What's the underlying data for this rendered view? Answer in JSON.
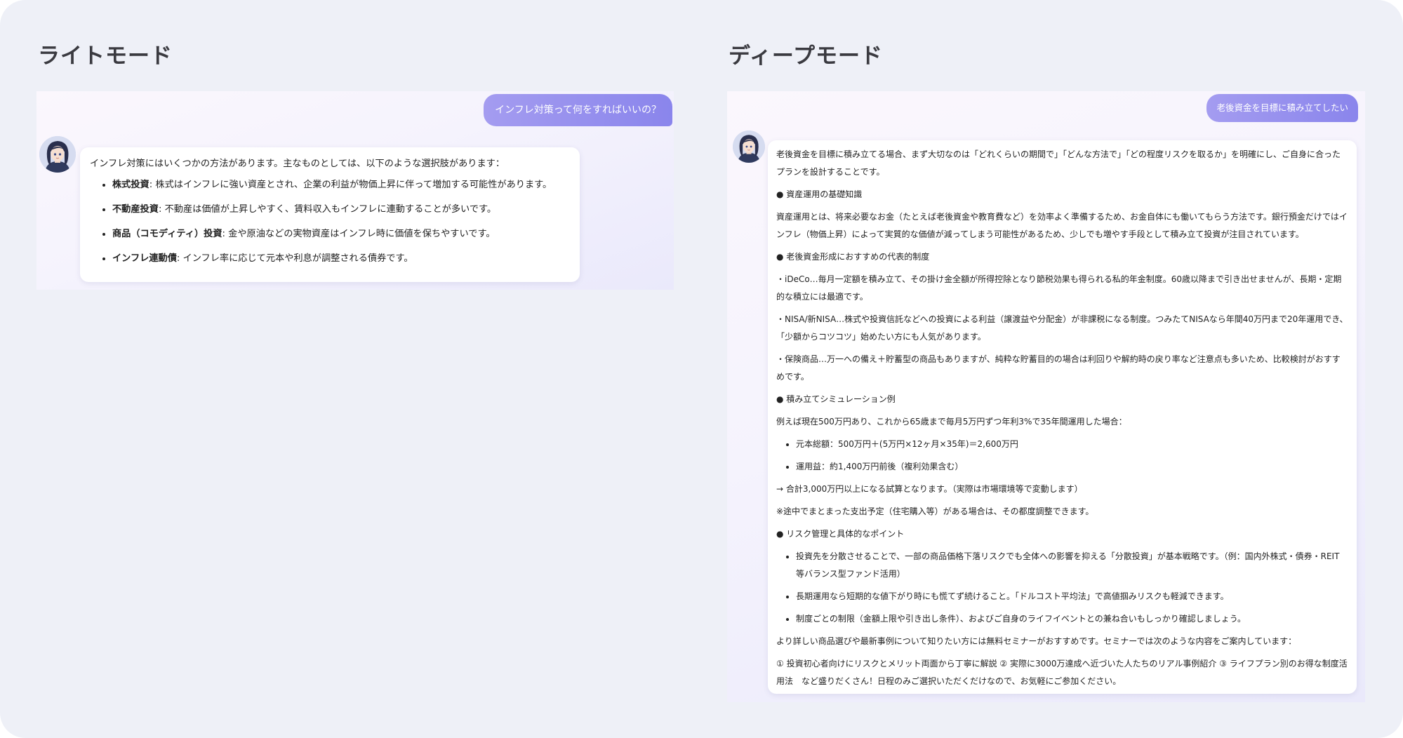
{
  "light": {
    "title": "ライトモード",
    "question": "インフレ対策って何をすればいいの？",
    "intro": "インフレ対策にはいくつかの方法があります。主なものとしては、以下のような選択肢があります：",
    "items": [
      {
        "term": "株式投資",
        "desc": ": 株式はインフレに強い資産とされ、企業の利益が物価上昇に伴って増加する可能性があります。"
      },
      {
        "term": "不動産投資",
        "desc": ": 不動産は価値が上昇しやすく、賃料収入もインフレに連動することが多いです。"
      },
      {
        "term": "商品（コモディティ）投資",
        "desc": ": 金や原油などの実物資産はインフレ時に価値を保ちやすいです。"
      },
      {
        "term": "インフレ連動債",
        "desc": ": インフレ率に応じて元本や利息が調整される債券です。"
      }
    ]
  },
  "deep": {
    "title": "ディープモード",
    "question": "老後資金を目標に積み立てしたい",
    "intro": "老後資金を目標に積み立てる場合、まず大切なのは「どれくらいの期間で」「どんな方法で」「どの程度リスクを取るか」を明確にし、ご自身に合ったプランを設計することです。",
    "h1": "● 資産運用の基礎知識",
    "p1": "資産運用とは、将来必要なお金（たとえば老後資金や教育費など）を効率よく準備するため、お金自体にも働いてもらう方法です。銀行預金だけではインフレ（物価上昇）によって実質的な価値が減ってしまう可能性があるため、少しでも増やす手段として積み立て投資が注目されています。",
    "h2": "● 老後資金形成におすすめの代表的制度",
    "p2": "・iDeCo…毎月一定額を積み立て、その掛け金全額が所得控除となり節税効果も得られる私的年金制度。60歳以降まで引き出せませんが、長期・定期的な積立には最適です。",
    "p3": "・NISA/新NISA…株式や投資信託などへの投資による利益（譲渡益や分配金）が非課税になる制度。つみたてNISAなら年間40万円まで20年運用でき、「少額からコツコツ」始めたい方にも人気があります。",
    "p4": "・保険商品…万一への備え＋貯蓄型の商品もありますが、純粋な貯蓄目的の場合は利回りや解約時の戻り率など注意点も多いため、比較検討がおすすめです。",
    "h3": "● 積み立てシミュレーション例",
    "p5": "例えば現在500万円あり、これから65歳まで毎月5万円ずつ年利3%で35年間運用した場合：",
    "sim": [
      "元本総額：500万円＋(5万円×12ヶ月×35年)＝2,600万円",
      "運用益：約1,400万円前後（複利効果含む）"
    ],
    "p6": "→ 合計3,000万円以上になる試算となります。（実際は市場環境等で変動します）",
    "p7": "※途中でまとまった支出予定（住宅購入等）がある場合は、その都度調整できます。",
    "h4": "● リスク管理と具体的なポイント",
    "risk": [
      "投資先を分散させることで、一部の商品価格下落リスクでも全体への影響を抑える「分散投資」が基本戦略です。（例：国内外株式・債券・REIT 等バランス型ファンド活用）",
      "長期運用なら短期的な値下がり時にも慌てず続けること。「ドルコスト平均法」で高値掴みリスクも軽減できます。",
      "制度ごとの制限（金額上限や引き出し条件）、およびご自身のライフイベントとの兼ね合いもしっかり確認しましょう。"
    ],
    "p8": "より詳しい商品選びや最新事例について知りたい方には無料セミナーがおすすめです。セミナーでは次のような内容をご案内しています：",
    "p9": "① 投資初心者向けにリスクとメリット両面から丁寧に解説 ② 実際に3000万達成へ近づいた人たちのリアル事例紹介 ③ ライフプラン別のお得な制度活用法　など盛りだくさん！日程のみご選択いただくだけなので、お気軽にご参加ください。"
  },
  "colors": {
    "background": "#eef0f7",
    "user_bubble": "#8f8aee",
    "title_text": "#3a3a40"
  }
}
